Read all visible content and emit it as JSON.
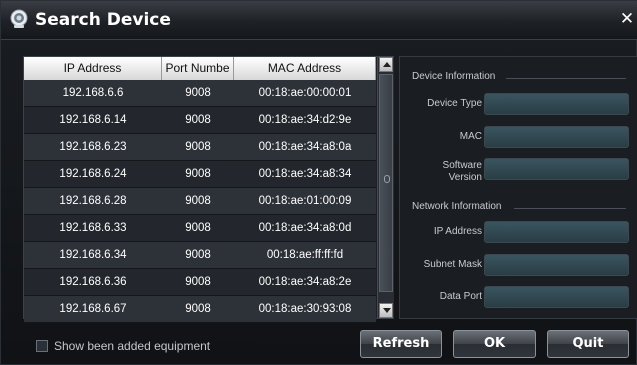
{
  "window": {
    "title": "Search Device",
    "close_glyph": "✕"
  },
  "table": {
    "headers": [
      "IP Address",
      "Port Numbe",
      "MAC Address"
    ],
    "rows": [
      [
        "192.168.6.6",
        "9008",
        "00:18:ae:00:00:01"
      ],
      [
        "192.168.6.14",
        "9008",
        "00:18:ae:34:d2:9e"
      ],
      [
        "192.168.6.23",
        "9008",
        "00:18:ae:34:a8:0a"
      ],
      [
        "192.168.6.24",
        "9008",
        "00:18:ae:34:a8:34"
      ],
      [
        "192.168.6.28",
        "9008",
        "00:18:ae:01:00:09"
      ],
      [
        "192.168.6.33",
        "9008",
        "00:18:ae:34:a8:0d"
      ],
      [
        "192.168.6.34",
        "9008",
        "00:18:ae:ff:ff:fd"
      ],
      [
        "192.168.6.36",
        "9008",
        "00:18:ae:34:a8:2e"
      ],
      [
        "192.168.6.67",
        "9008",
        "00:18:ae:30:93:08"
      ]
    ]
  },
  "device_info": {
    "section_label": "Device Information",
    "device_type_label": "Device Type",
    "mac_label": "MAC",
    "software_version_label_line1": "Software",
    "software_version_label_line2": "Version",
    "device_type_value": "",
    "mac_value": "",
    "software_version_value": ""
  },
  "network_info": {
    "section_label": "Network Information",
    "ip_address_label": "IP Address",
    "subnet_mask_label": "Subnet Mask",
    "data_port_label": "Data Port",
    "ip_address_value": "",
    "subnet_mask_value": "",
    "data_port_value": ""
  },
  "footer": {
    "checkbox_label": "Show been added equipment",
    "checkbox_checked": false,
    "refresh_label": "Refresh",
    "ok_label": "OK",
    "quit_label": "Quit"
  },
  "colors": {
    "row_alt": "#2d3239",
    "row_base": "#23272d",
    "field_fill": "#2f4650"
  }
}
